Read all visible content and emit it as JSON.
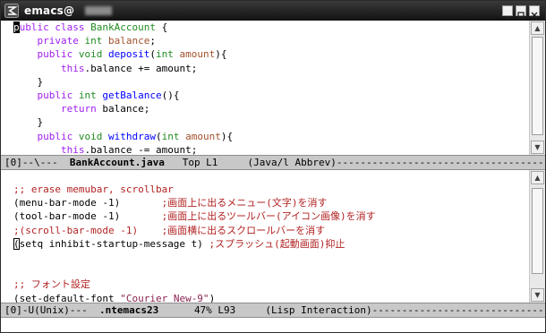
{
  "window": {
    "title_prefix": "emacs@",
    "buttons": [
      "minimize",
      "maximize",
      "close"
    ]
  },
  "top_pane": {
    "lines": [
      [
        {
          "t": "p",
          "c": "cursor"
        },
        {
          "t": "ublic",
          "c": "kw"
        },
        {
          "t": " "
        },
        {
          "t": "class",
          "c": "kw"
        },
        {
          "t": " "
        },
        {
          "t": "BankAccount",
          "c": "type"
        },
        {
          "t": " {"
        }
      ],
      [
        {
          "t": "    "
        },
        {
          "t": "private",
          "c": "kw"
        },
        {
          "t": " "
        },
        {
          "t": "int",
          "c": "type"
        },
        {
          "t": " "
        },
        {
          "t": "balance",
          "c": "var"
        },
        {
          "t": ";"
        }
      ],
      [
        {
          "t": "    "
        },
        {
          "t": "public",
          "c": "kw"
        },
        {
          "t": " "
        },
        {
          "t": "void",
          "c": "type"
        },
        {
          "t": " "
        },
        {
          "t": "deposit",
          "c": "fn"
        },
        {
          "t": "("
        },
        {
          "t": "int",
          "c": "type"
        },
        {
          "t": " "
        },
        {
          "t": "amount",
          "c": "var"
        },
        {
          "t": "){"
        }
      ],
      [
        {
          "t": "        "
        },
        {
          "t": "this",
          "c": "kw"
        },
        {
          "t": ".balance += amount;"
        }
      ],
      [
        {
          "t": "    }"
        }
      ],
      [
        {
          "t": "    "
        },
        {
          "t": "public",
          "c": "kw"
        },
        {
          "t": " "
        },
        {
          "t": "int",
          "c": "type"
        },
        {
          "t": " "
        },
        {
          "t": "getBalance",
          "c": "fn"
        },
        {
          "t": "(){"
        }
      ],
      [
        {
          "t": "        "
        },
        {
          "t": "return",
          "c": "kw"
        },
        {
          "t": " balance;"
        }
      ],
      [
        {
          "t": "    }"
        }
      ],
      [
        {
          "t": "    "
        },
        {
          "t": "public",
          "c": "kw"
        },
        {
          "t": " "
        },
        {
          "t": "void",
          "c": "type"
        },
        {
          "t": " "
        },
        {
          "t": "withdraw",
          "c": "fn"
        },
        {
          "t": "("
        },
        {
          "t": "int",
          "c": "type"
        },
        {
          "t": " "
        },
        {
          "t": "amount",
          "c": "var"
        },
        {
          "t": "){"
        }
      ],
      [
        {
          "t": "        "
        },
        {
          "t": "this",
          "c": "kw"
        },
        {
          "t": ".balance -= amount;"
        }
      ]
    ]
  },
  "top_modeline": {
    "pre": "[0]--\\---  ",
    "buffer": "BankAccount.java",
    "post": "   Top L1     (Java/l Abbrev)-----------------------------------------------"
  },
  "bottom_pane": {
    "lines": [
      [
        {
          "t": ";; erase memubar, scrollbar",
          "c": "cm"
        }
      ],
      [
        {
          "t": "(menu-bar-mode -1)       "
        },
        {
          "t": ";画面上に出るメニュー(文字)を消す",
          "c": "cm"
        }
      ],
      [
        {
          "t": "(tool-bar-mode -1)       "
        },
        {
          "t": ";画面上に出るツールバー(アイコン画像)を消す",
          "c": "cm"
        }
      ],
      [
        {
          "t": ";(scroll-bar-mode -1)    ;画面横に出るスクロールバーを消す",
          "c": "cm"
        }
      ],
      [
        {
          "t": "(",
          "c": "cursor-hollow"
        },
        {
          "t": "setq inhibit-startup-message t) "
        },
        {
          "t": ";スプラッシュ(起動画面)抑止",
          "c": "cm"
        }
      ],
      [
        {
          "t": ""
        }
      ],
      [
        {
          "t": ""
        }
      ],
      [
        {
          "t": ";; フォント設定",
          "c": "cm"
        }
      ],
      [
        {
          "t": "(set-default-font "
        },
        {
          "t": "\"Courier New-9\"",
          "c": "str"
        },
        {
          "t": ")"
        }
      ]
    ]
  },
  "bottom_modeline": {
    "pre": "[0]-U(Unix)---  ",
    "buffer": ".ntemacs23",
    "post": "      47% L93     (Lisp Interaction)--------------------------------------"
  }
}
